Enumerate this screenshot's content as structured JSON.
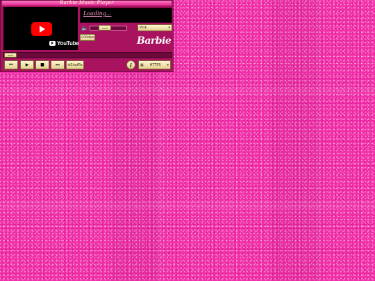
{
  "player": {
    "title": "Barbie Music Player",
    "status_text": "Loading...",
    "video": {
      "logo_text": "YouTube",
      "play_icon": "youtube-play-icon"
    },
    "volume": {
      "icon": "speaker-icon",
      "level": 0.35
    },
    "playlist_select": {
      "selected": "Pink",
      "arrow": "▾"
    },
    "video_button_label": "Video",
    "brand_logo": "Barbie",
    "seek": {
      "progress": 0
    },
    "transport": {
      "prev": "⏮",
      "play": "▶",
      "stop": "■",
      "next": "⏭"
    },
    "shuffle_label": "Shuffle",
    "info_label": "i",
    "quality_select": {
      "selected": "HTTPS",
      "arrow": "▾"
    }
  },
  "colors": {
    "background": "#f02fa8",
    "player_frame": "#a8125f",
    "button_face": "#fff6d0"
  }
}
